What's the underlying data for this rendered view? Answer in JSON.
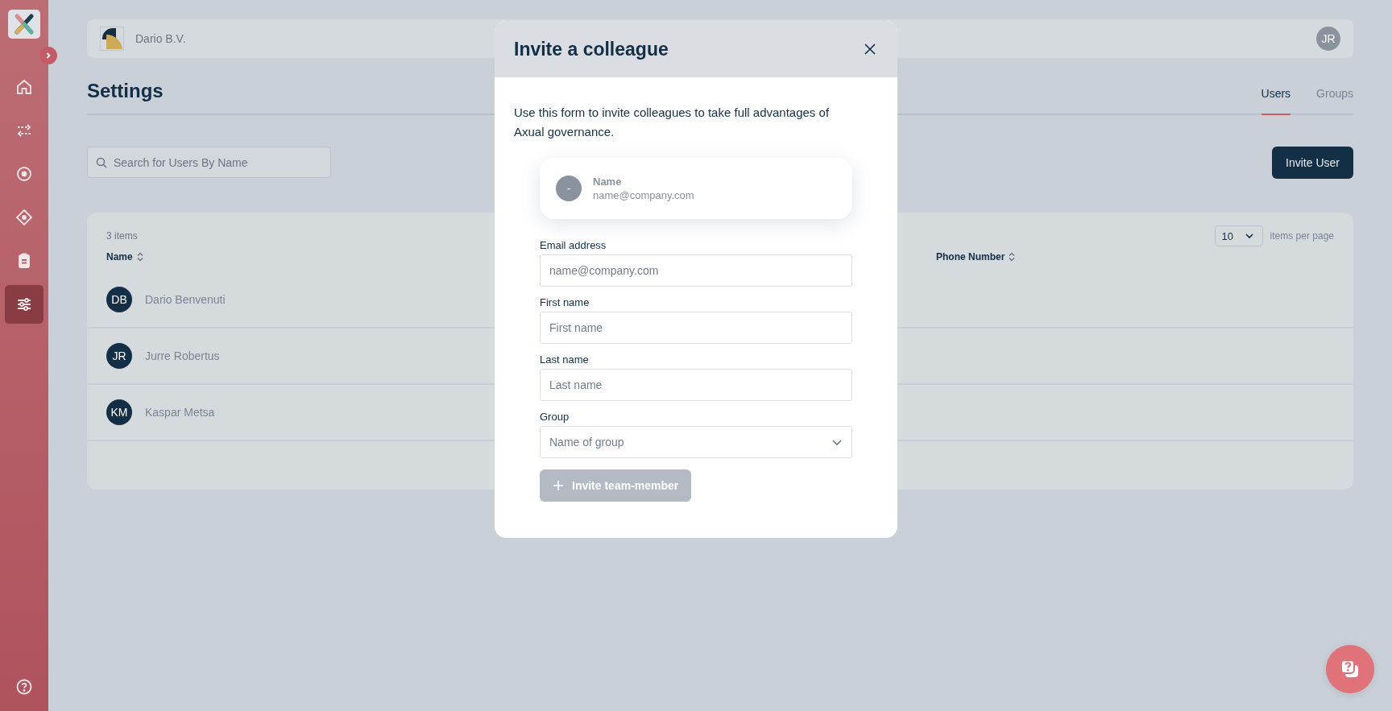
{
  "sidebar": {
    "items": [
      {
        "kind": "home",
        "selected": false
      },
      {
        "kind": "transfer",
        "selected": false
      },
      {
        "kind": "target",
        "selected": false
      },
      {
        "kind": "diamond",
        "selected": false
      },
      {
        "kind": "clipboard",
        "selected": false
      },
      {
        "kind": "sliders",
        "selected": true
      }
    ],
    "footer": {
      "kind": "help"
    }
  },
  "header": {
    "org": "Dario B.V.",
    "avatar": "JR"
  },
  "page": {
    "title": "Settings",
    "tabs": [
      {
        "label": "Users",
        "selected": true
      },
      {
        "label": "Groups",
        "selected": false
      }
    ]
  },
  "search": {
    "placeholder": "Search for Users By Name"
  },
  "invite_button": "Invite User",
  "table": {
    "count": "3 items",
    "page_size": "10",
    "page_size_label": "items per page",
    "columns": [
      {
        "label": "Name"
      },
      {
        "label": "Phone Number"
      }
    ],
    "rows": [
      {
        "initials": "DB",
        "name": "Dario Benvenuti"
      },
      {
        "initials": "JR",
        "name": "Jurre Robertus"
      },
      {
        "initials": "KM",
        "name": "Kaspar Metsa"
      }
    ]
  },
  "dialog": {
    "title": "Invite a colleague",
    "intro": "Use this form to invite colleagues to take full advantages of Axual governance.",
    "preview": {
      "initials": "-",
      "name": "Name",
      "email": "name@company.com"
    },
    "fields": [
      {
        "kind": "text",
        "label": "Email address",
        "placeholder": "name@company.com"
      },
      {
        "kind": "text",
        "label": "First name",
        "placeholder": "First name"
      },
      {
        "kind": "text",
        "label": "Last name",
        "placeholder": "Last name"
      },
      {
        "kind": "select",
        "label": "Group",
        "placeholder": "Name of group"
      }
    ],
    "submit": {
      "label": "Invite team-member",
      "disabled": true
    }
  }
}
